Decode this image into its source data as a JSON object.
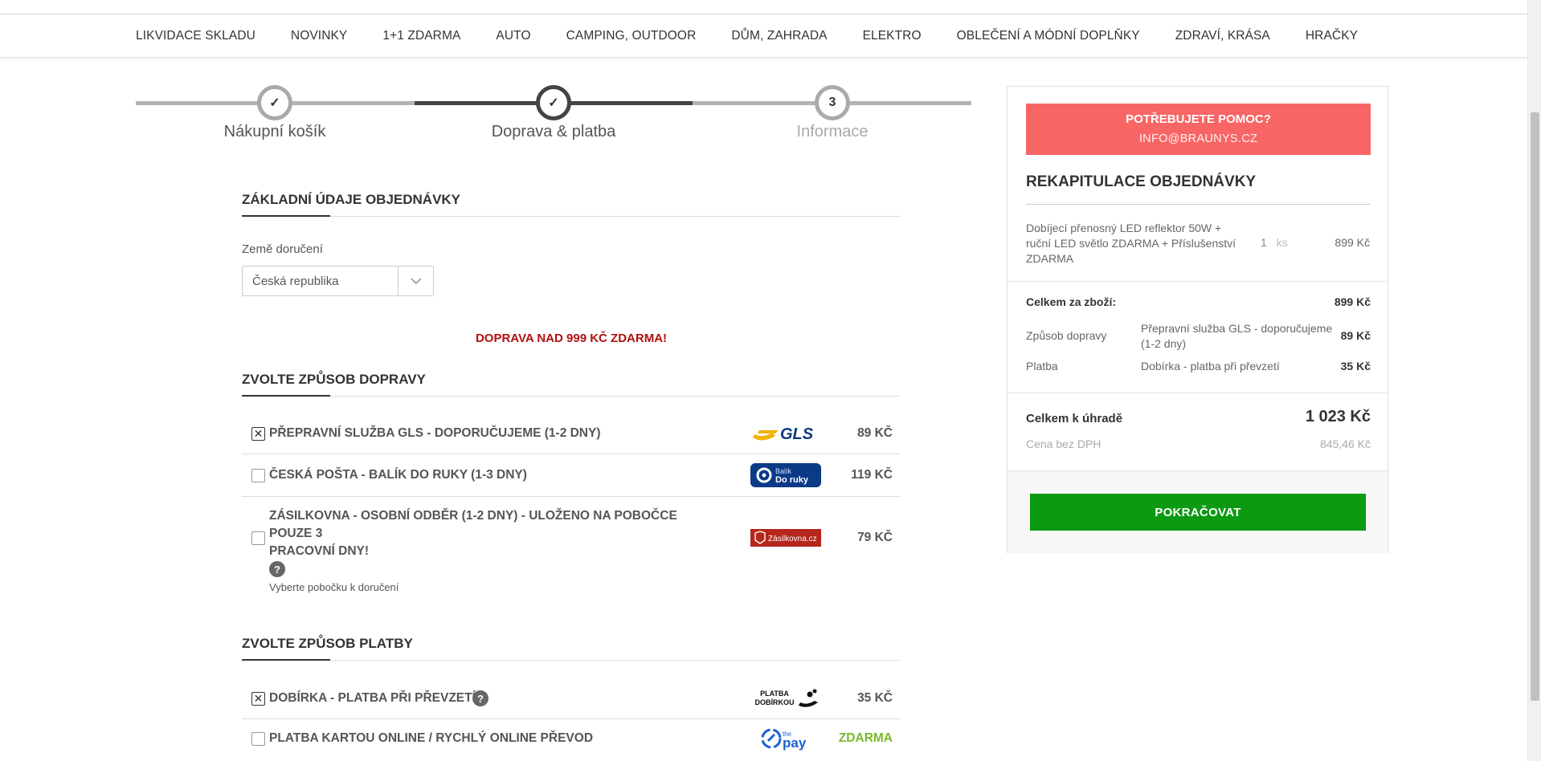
{
  "nav": {
    "items": [
      "LIKVIDACE SKLADU",
      "NOVINKY",
      "1+1 ZDARMA",
      "AUTO",
      "CAMPING, OUTDOOR",
      "DŮM, ZAHRADA",
      "ELEKTRO",
      "OBLEČENÍ A MÓDNÍ DOPLŇKY",
      "ZDRAVÍ, KRÁSA",
      "HRAČKY"
    ]
  },
  "steps": {
    "step1": {
      "label": "Nákupní košík",
      "mark": "✓"
    },
    "step2": {
      "label": "Doprava & platba",
      "mark": "✓"
    },
    "step3": {
      "label": "Informace",
      "mark": "3"
    }
  },
  "basic": {
    "title": "ZÁKLADNÍ ÚDAJE OBJEDNÁVKY",
    "country_label": "Země doručení",
    "country_value": "Česká republika"
  },
  "free_shipping_note": "DOPRAVA NAD 999 KČ ZDARMA!",
  "shipping": {
    "title": "ZVOLTE ZPŮSOB DOPRAVY",
    "options": [
      {
        "label": "PŘEPRAVNÍ SLUŽBA GLS - DOPORUČUJEME (1-2 DNY)",
        "price": "89 KČ",
        "checked": true,
        "logo": "GLS"
      },
      {
        "label": "ČESKÁ POŠTA - BALÍK DO RUKY (1-3 DNY)",
        "price": "119 KČ",
        "checked": false,
        "logo_line1": "Balík",
        "logo_line2": "Do ruky"
      },
      {
        "label_line1": "ZÁSILKOVNA - OSOBNÍ ODBĚR (1-2 DNY) - ULOŽENO NA POBOČCE POUZE 3",
        "label_line2": "PRACOVNÍ DNY!",
        "help": "?",
        "sub": "Vyberte pobočku k doručení",
        "price": "79 KČ",
        "checked": false,
        "logo": "Zásilkovna.cz"
      }
    ]
  },
  "payment": {
    "title": "ZVOLTE ZPŮSOB PLATBY",
    "options": [
      {
        "label": "DOBÍRKA - PLATBA PŘI PŘEVZETÍ",
        "help": "?",
        "price": "35 KČ",
        "checked": true,
        "logo_line1": "PLATBA",
        "logo_line2": "DOBÍRKOU"
      },
      {
        "label": "PLATBA KARTOU ONLINE / RYCHLÝ ONLINE PŘEVOD",
        "price": "ZDARMA",
        "checked": false,
        "logo_line1": "the",
        "logo_line2": "pay"
      }
    ]
  },
  "summary": {
    "help_title": "POTŘEBUJETE POMOC?",
    "help_email": "INFO@BRAUNYS.CZ",
    "title": "REKAPITULACE OBJEDNÁVKY",
    "item_name": "Dobíjecí přenosný LED reflektor 50W + ruční LED světlo ZDARMA + Příslušenství ZDARMA",
    "item_qty": "1",
    "item_unit": "ks",
    "item_price": "899 Kč",
    "goods_total_label": "Celkem za zboží:",
    "goods_total": "899 Kč",
    "shipping_label": "Způsob dopravy",
    "shipping_value": "Přepravní služba GLS - doporučujeme (1-2 dny)",
    "shipping_price": "89 Kč",
    "payment_label": "Platba",
    "payment_value": "Dobírka - platba při převzetí",
    "payment_price": "35 Kč",
    "total_label": "Celkem k úhradě",
    "total": "1 023 Kč",
    "no_vat_label": "Cena bez DPH",
    "no_vat": "845,46 Kč",
    "continue_label": "POKRAČOVAT"
  }
}
